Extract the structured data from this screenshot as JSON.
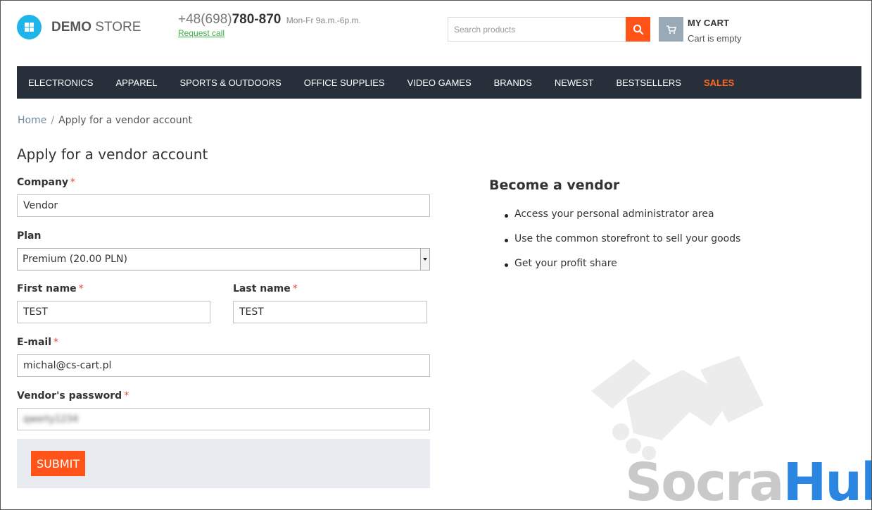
{
  "header": {
    "logo_bold": "DEMO",
    "logo_light": "STORE",
    "phone_code": "+48(698)",
    "phone_number": "780-870",
    "phone_hours": "Mon-Fr 9a.m.-6p.m.",
    "request_call": "Request call",
    "search_placeholder": "Search products",
    "cart_title": "MY CART",
    "cart_status": "Cart is empty"
  },
  "nav": {
    "items": [
      "ELECTRONICS",
      "APPAREL",
      "SPORTS & OUTDOORS",
      "OFFICE SUPPLIES",
      "VIDEO GAMES",
      "BRANDS",
      "NEWEST",
      "BESTSELLERS",
      "SALES"
    ]
  },
  "breadcrumb": {
    "home": "Home",
    "separator": "/",
    "current": "Apply for a vendor account"
  },
  "page_title": "Apply for a vendor account",
  "form": {
    "required_mark": "*",
    "company_label": "Company",
    "company_value": "Vendor",
    "plan_label": "Plan",
    "plan_value": "Premium (20.00 PLN)",
    "first_name_label": "First name",
    "first_name_value": "TEST",
    "last_name_label": "Last name",
    "last_name_value": "TEST",
    "email_label": "E-mail",
    "email_value": "michal@cs-cart.pl",
    "password_label": "Vendor's password",
    "password_value": "qwerty1234",
    "submit_label": "SUBMIT"
  },
  "vendor_panel": {
    "title": "Become a vendor",
    "benefits": [
      "Access your personal administrator area",
      "Use the common storefront to sell your goods",
      "Get your profit share"
    ]
  },
  "watermark": {
    "part1": "Socra",
    "part2": "Hub"
  },
  "colors": {
    "accent": "#ff5319",
    "nav_bg": "#262f3a",
    "logo": "#1fb5ea",
    "watermark_blue": "#2a86e0"
  }
}
